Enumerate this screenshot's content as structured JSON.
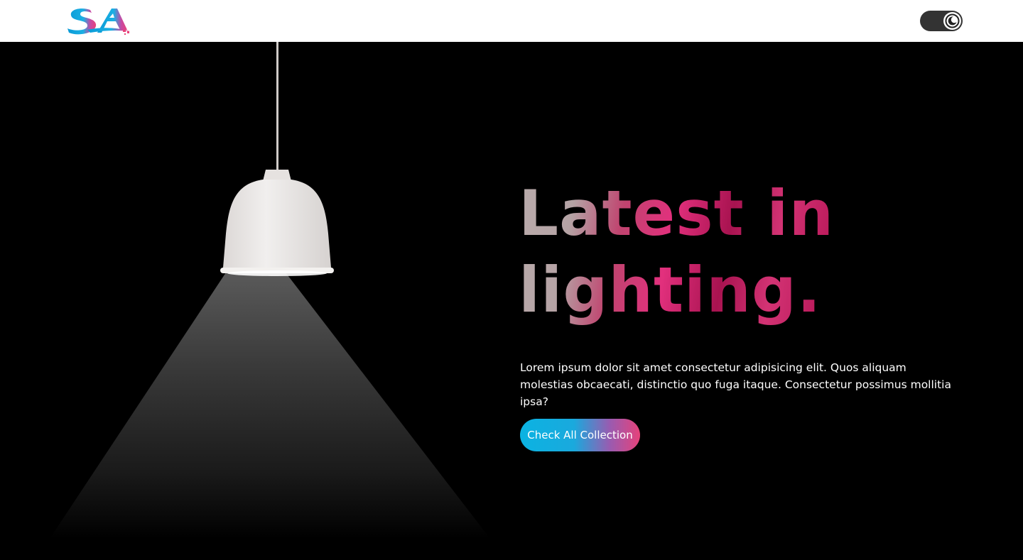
{
  "navbar": {
    "logo_text": "SA",
    "theme_toggle_icon": "moon-icon"
  },
  "hero": {
    "headline_line1": "Latest in",
    "headline_line2": "lighting.",
    "description": "Lorem ipsum dolor sit amet consectetur adipisicing elit. Quos aliquam molestias obcaecati, distinctio quo fuga itaque. Consectetur possimus mollitia ipsa?",
    "cta_label": "Check All Collection"
  },
  "colors": {
    "brand_blue": "#0bb3e2",
    "brand_pink": "#e6427a",
    "background": "#000000",
    "navbar": "#ffffff"
  }
}
